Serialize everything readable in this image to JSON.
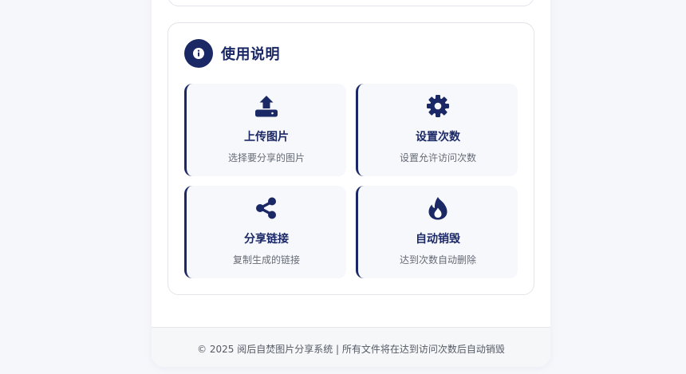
{
  "help": {
    "title": "使用说明",
    "icon": "info-icon",
    "features": [
      {
        "icon": "upload-icon",
        "title": "上传图片",
        "desc": "选择要分享的图片"
      },
      {
        "icon": "gear-icon",
        "title": "设置次数",
        "desc": "设置允许访问次数"
      },
      {
        "icon": "share-icon",
        "title": "分享链接",
        "desc": "复制生成的链接"
      },
      {
        "icon": "flame-icon",
        "title": "自动销毁",
        "desc": "达到次数自动删除"
      }
    ]
  },
  "footer": {
    "text": "© 2025 阅后自焚图片分享系统 | 所有文件将在达到访问次数后自动销毁"
  },
  "colors": {
    "primary": "#1b2866",
    "card_background": "#f7f8fc",
    "page_background": "#f6f7fb"
  }
}
